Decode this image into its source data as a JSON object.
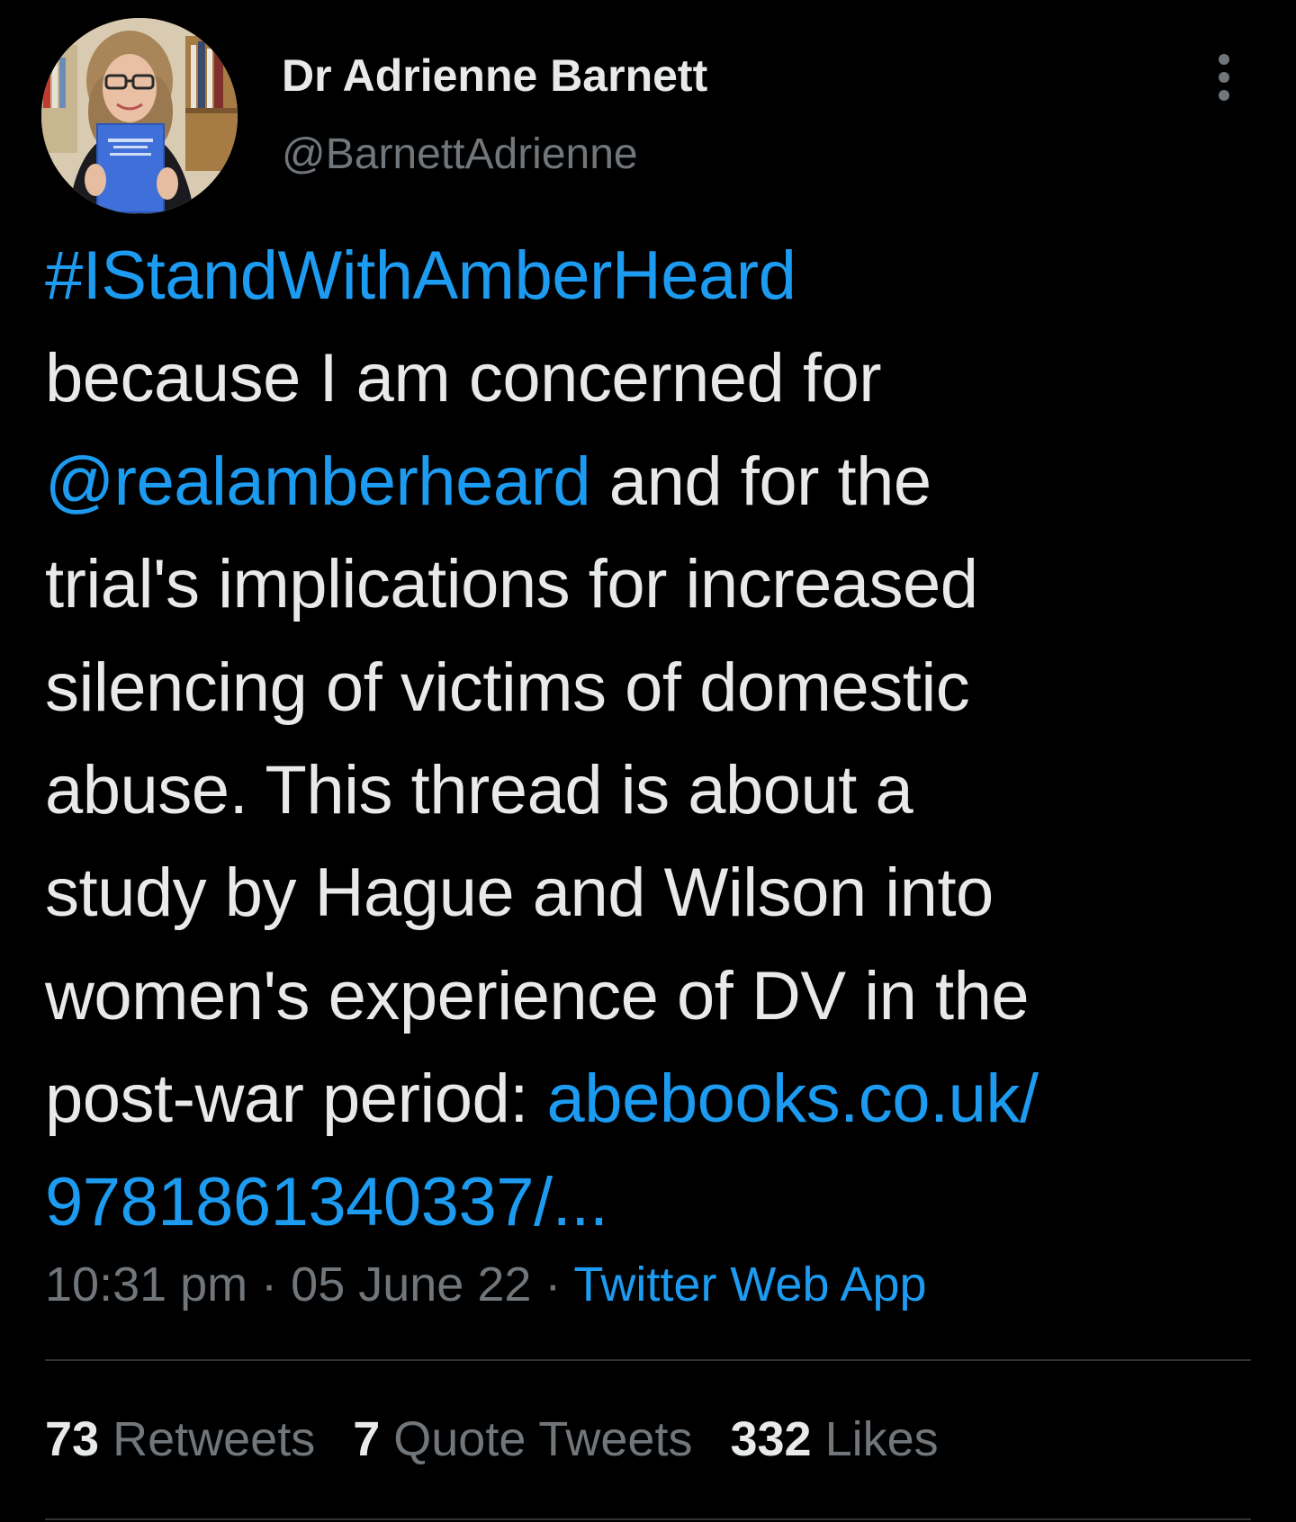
{
  "author": {
    "display_name": "Dr Adrienne Barnett",
    "handle": "@BarnettAdrienne"
  },
  "tweet": {
    "lines": [
      [
        {
          "text": "#IStandWithAmberHeard",
          "link": true
        }
      ],
      [
        {
          "text": "because I am concerned for",
          "link": false
        }
      ],
      [
        {
          "text": "@realamberheard",
          "link": true
        },
        {
          "text": " and for the",
          "link": false
        }
      ],
      [
        {
          "text": "trial's implications for increased",
          "link": false
        }
      ],
      [
        {
          "text": "silencing of victims of domestic",
          "link": false
        }
      ],
      [
        {
          "text": "abuse. This thread is about a",
          "link": false
        }
      ],
      [
        {
          "text": "study by Hague and Wilson into",
          "link": false
        }
      ],
      [
        {
          "text": "women's experience of DV in the",
          "link": false
        }
      ],
      [
        {
          "text": "post-war period: ",
          "link": false
        },
        {
          "text": "abebooks.co.uk/",
          "link": true
        }
      ],
      [
        {
          "text": "9781861340337/...",
          "link": true
        }
      ]
    ]
  },
  "meta": {
    "time": "10:31 pm",
    "separator": " · ",
    "date": "05 June 22",
    "source": "Twitter Web App"
  },
  "stats": {
    "retweets_count": "73",
    "retweets_label": "Retweets",
    "quotes_count": "7",
    "quotes_label": "Quote Tweets",
    "likes_count": "332",
    "likes_label": "Likes"
  },
  "colors": {
    "background": "#000000",
    "text": "#e7e9ea",
    "secondary": "#71767b",
    "accent": "#1d9bf0",
    "divider": "#2f3336"
  },
  "icons": {
    "more": "more-vertical-icon"
  }
}
